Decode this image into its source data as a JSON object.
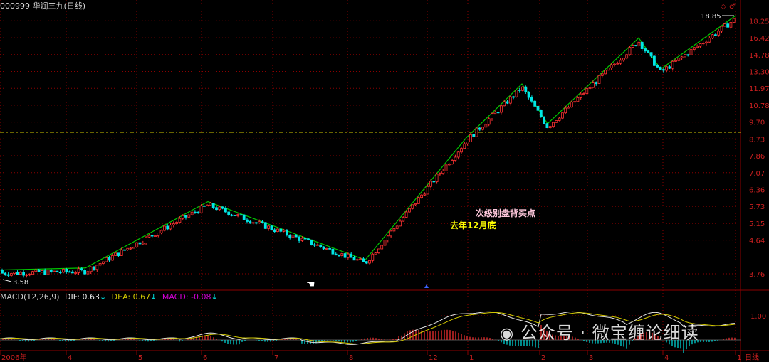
{
  "header": {
    "title": "000999 华润三九(日线)",
    "top_right_icons": [
      "◇",
      "♂"
    ]
  },
  "main_chart": {
    "price_labels": [
      "18.25",
      "16.42",
      "14.78",
      "13.30",
      "11.97",
      "10.78",
      "9.70",
      "8.73",
      "7.86",
      "7.07",
      "6.36",
      "5.73",
      "5.15",
      "4.64",
      "3.76"
    ],
    "high_label": "18.85",
    "low_label": "3.58",
    "annotation_red": "次级别盘背买点",
    "annotation_yellow": "去年12月底",
    "hline_value": 9.1
  },
  "macd": {
    "label": "MACD(12,26,9)",
    "dif_label": "DIF:",
    "dif_value": "0.63",
    "dea_label": "DEA:",
    "dea_value": "0.67",
    "macd_label": "MACD:",
    "macd_value": "-0.08",
    "axis_label": "1.00"
  },
  "x_axis": {
    "labels": [
      "2006年",
      "4",
      "5",
      "6",
      "7",
      "8",
      "12",
      "1",
      "2",
      "3",
      "4",
      "1",
      "日线"
    ]
  },
  "watermark": "公众号 · 微宝缠论细读",
  "colors": {
    "up": "#ff3232",
    "down": "#00e6e6",
    "zigzag": "#00c800",
    "dif": "#e6e6e6",
    "dea": "#d2c800",
    "hline": "#d2c800",
    "grid": "#8b0000"
  },
  "chart_data": {
    "type": "candlestick",
    "zigzag": {
      "points": [
        {
          "x": "2006-01",
          "y": 3.85
        },
        {
          "x": "2006-04",
          "y": 3.9
        },
        {
          "x": "2006-06",
          "y": 5.9
        },
        {
          "x": "2006-08",
          "y": 4.1
        },
        {
          "x": "2006-12",
          "y": 8.8
        },
        {
          "x": "2007-02a",
          "y": 12.3
        },
        {
          "x": "2007-02b",
          "y": 9.6
        },
        {
          "x": "2007-03",
          "y": 16.4
        },
        {
          "x": "2007-04",
          "y": 13.5
        },
        {
          "x": "2007-05",
          "y": 18.85
        }
      ]
    },
    "price_axis": [
      18.25,
      16.42,
      14.78,
      13.3,
      11.97,
      10.78,
      9.7,
      8.73,
      7.86,
      7.07,
      6.36,
      5.73,
      5.15,
      4.64,
      3.76
    ],
    "high": 18.85,
    "low": 3.58,
    "annotations": [
      "次级别盘背买点",
      "去年12月底"
    ],
    "macd_params": "12,26,9",
    "dif": 0.63,
    "dea": 0.67,
    "macd": -0.08
  }
}
